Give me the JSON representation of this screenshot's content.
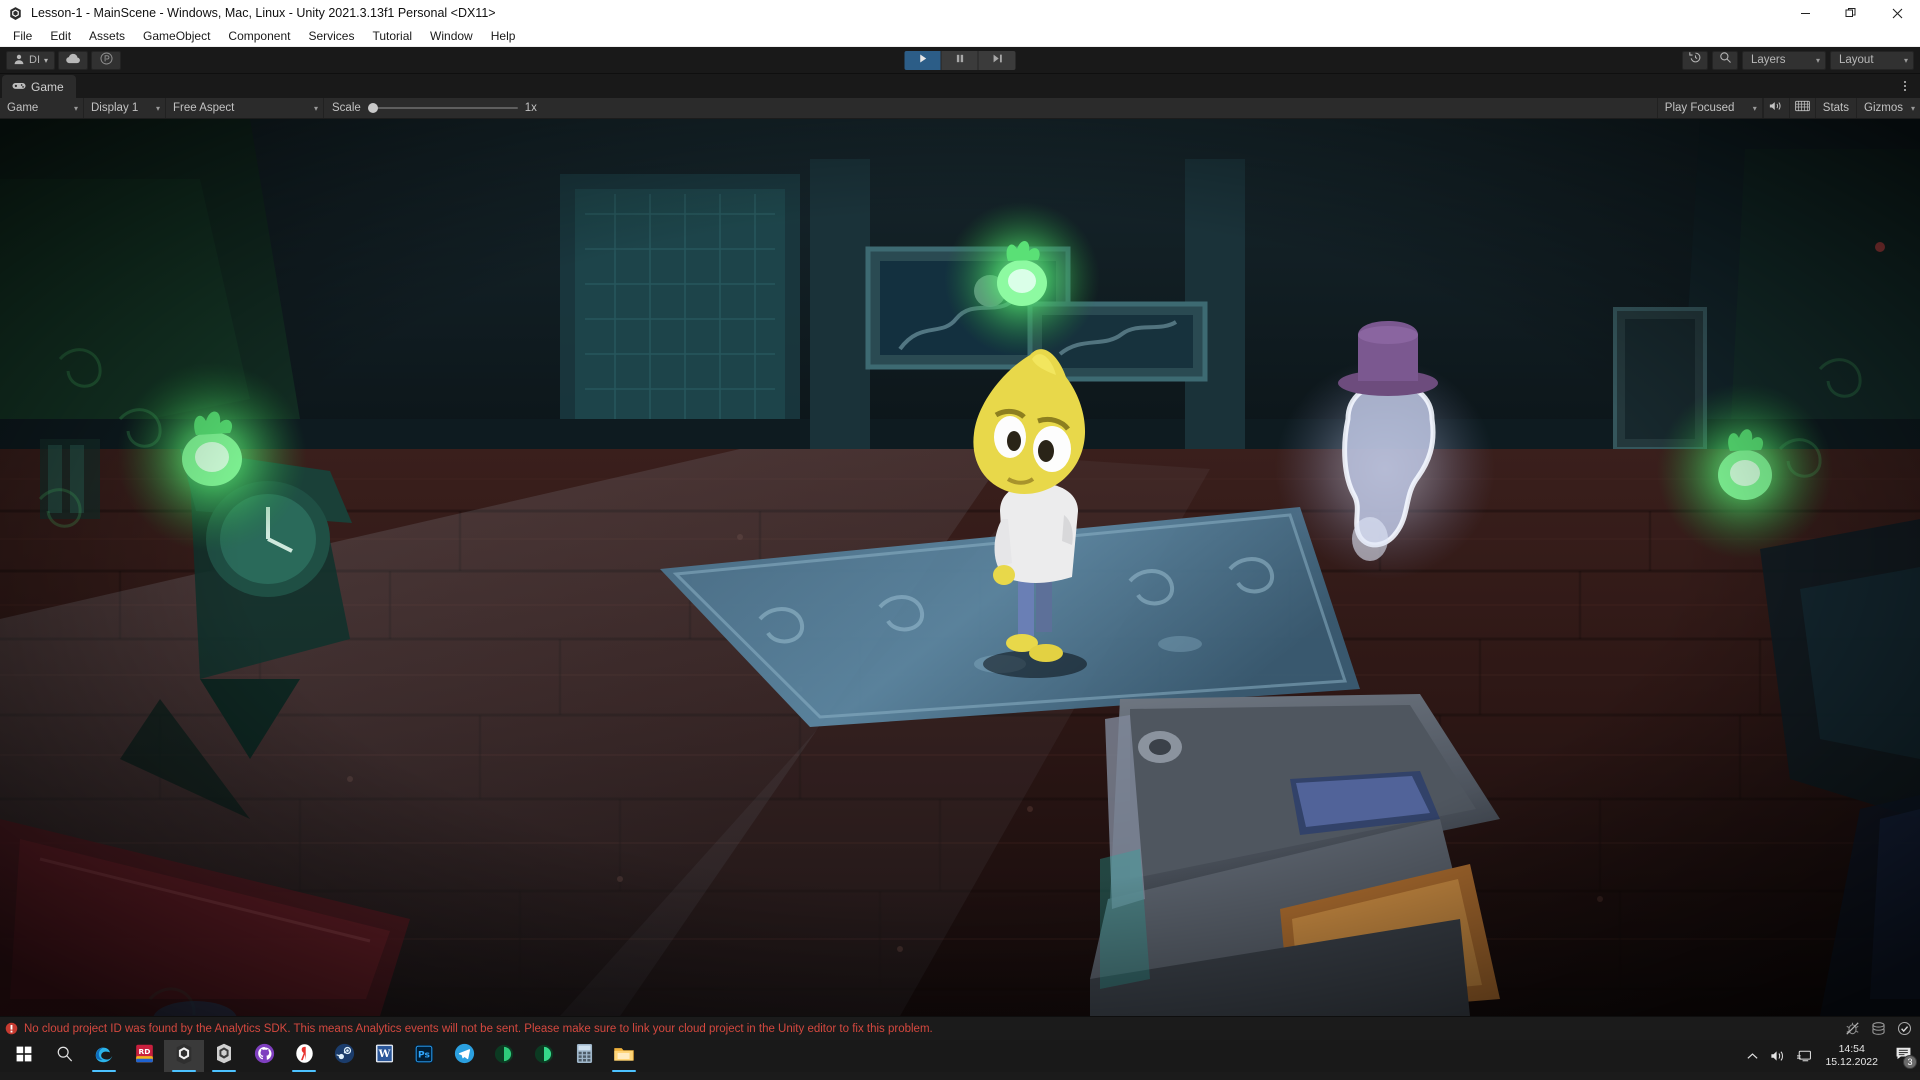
{
  "window": {
    "title": "Lesson-1 - MainScene - Windows, Mac, Linux - Unity 2021.3.13f1 Personal <DX11>",
    "app_icon": "unity-icon",
    "minimize_label": "—",
    "maximize_label": "❐",
    "close_label": "✕"
  },
  "menubar": {
    "items": [
      {
        "label": "File"
      },
      {
        "label": "Edit"
      },
      {
        "label": "Assets"
      },
      {
        "label": "GameObject"
      },
      {
        "label": "Component"
      },
      {
        "label": "Services"
      },
      {
        "label": "Tutorial"
      },
      {
        "label": "Window"
      },
      {
        "label": "Help"
      }
    ]
  },
  "toolbar": {
    "account_label": "DI",
    "account_icon": "person-icon",
    "account_caret": "▾",
    "cloud_icon": "cloud-icon",
    "collab_icon": "plastic-scm-icon",
    "play_icon": "play-icon",
    "pause_icon": "pause-icon",
    "step_icon": "step-forward-icon",
    "play_state": "playing",
    "undo_history_icon": "history-undo-icon",
    "search_icon": "search-icon",
    "layers_label": "Layers",
    "layout_label": "Layout",
    "caret": "▾"
  },
  "tabs": {
    "active": "Game",
    "items": [
      {
        "label": "Game",
        "icon": "gamepad-icon"
      }
    ],
    "options_icon": "more-vertical-icon"
  },
  "game_toolbar": {
    "view_mode": "Game",
    "display": "Display 1",
    "aspect": "Free Aspect",
    "scale_label": "Scale",
    "scale_value": "1x",
    "scale_percent": 0,
    "play_mode_focus": "Play Focused",
    "mute_icon": "speaker-audio-icon",
    "fullscreen_icon": "grid-screen-icon",
    "stats_label": "Stats",
    "gizmos_label": "Gizmos",
    "caret": "▾"
  },
  "game_scene": {
    "description": "Dark haunted mansion interior room rendered in play mode",
    "player": {
      "name": "lemon-head-character",
      "head_color": "#e8d84a",
      "shirt_color": "#e9e9ea",
      "pants_color": "#6a7fb5",
      "shoes_color": "#e8d84a"
    },
    "ghost": {
      "name": "top-hat-ghost",
      "body_color": "#b9c2de",
      "hat_color": "#6d4c7d"
    },
    "lamps": [
      {
        "name": "wall-lamp-left",
        "color": "#4fe06a"
      },
      {
        "name": "wall-lamp-back",
        "color": "#5cf07a"
      },
      {
        "name": "wall-lamp-right",
        "color": "#4fe06a"
      }
    ],
    "props": [
      {
        "name": "blue-carpet"
      },
      {
        "name": "wooden-floor"
      },
      {
        "name": "framed-paintings"
      },
      {
        "name": "grandfather-clock"
      },
      {
        "name": "wooden-chest"
      },
      {
        "name": "red-carpet"
      }
    ]
  },
  "status": {
    "message": "No cloud project ID was found by the Analytics SDK. This means Analytics events will not be sent. Please make sure to link your cloud project in the Unity editor to fix this problem.",
    "message_color": "#d4483f",
    "error_icon": "error-circle-icon",
    "icons": [
      {
        "name": "debugger-disabled-icon"
      },
      {
        "name": "cache-server-icon"
      },
      {
        "name": "check-circle-icon"
      }
    ]
  },
  "taskbar": {
    "start_icon": "windows-start-icon",
    "search_icon": "search-icon",
    "apps": [
      {
        "name": "edge",
        "icon": "edge-icon",
        "active": false,
        "running": true
      },
      {
        "name": "rider",
        "icon": "rider-icon",
        "active": false,
        "running": false
      },
      {
        "name": "unity-editor",
        "icon": "unity-icon",
        "active": true,
        "running": true
      },
      {
        "name": "unity-hub",
        "icon": "unity-hub-icon",
        "active": false,
        "running": true
      },
      {
        "name": "github-desktop",
        "icon": "github-icon",
        "active": false,
        "running": false
      },
      {
        "name": "yandex-browser",
        "icon": "yandex-icon",
        "active": false,
        "running": true
      },
      {
        "name": "steam",
        "icon": "steam-icon",
        "active": false,
        "running": false
      },
      {
        "name": "word",
        "icon": "word-icon",
        "active": false,
        "running": false
      },
      {
        "name": "photoshop",
        "icon": "photoshop-icon",
        "active": false,
        "running": false
      },
      {
        "name": "telegram",
        "icon": "telegram-icon",
        "active": false,
        "running": false
      },
      {
        "name": "app-green-one",
        "icon": "green-circle-icon",
        "active": false,
        "running": false
      },
      {
        "name": "app-green-two",
        "icon": "green-circle-icon",
        "active": false,
        "running": false
      },
      {
        "name": "calculator",
        "icon": "calculator-icon",
        "active": false,
        "running": false
      },
      {
        "name": "file-explorer",
        "icon": "folder-icon",
        "active": false,
        "running": true
      }
    ],
    "tray": {
      "chevron_icon": "chevron-up-icon",
      "volume_icon": "volume-icon",
      "network_icon": "network-monitor-icon",
      "time": "14:54",
      "date": "15.12.2022",
      "notification_icon": "notification-icon",
      "notification_count": "3"
    }
  }
}
